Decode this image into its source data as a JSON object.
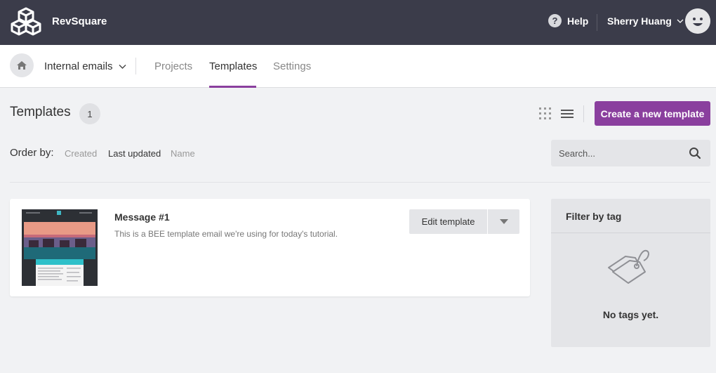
{
  "app": {
    "name": "RevSquare"
  },
  "topbar": {
    "help_label": "Help",
    "user_name": "Sherry Huang"
  },
  "subnav": {
    "project": "Internal emails",
    "tabs": [
      {
        "label": "Projects"
      },
      {
        "label": "Templates"
      },
      {
        "label": "Settings"
      }
    ]
  },
  "header": {
    "title": "Templates",
    "count": "1",
    "create_label": "Create a new template"
  },
  "order": {
    "label": "Order by:",
    "options": [
      {
        "label": "Created"
      },
      {
        "label": "Last updated"
      },
      {
        "label": "Name"
      }
    ]
  },
  "search": {
    "placeholder": "Search..."
  },
  "templates": [
    {
      "title": "Message #1",
      "description": "This is a BEE template email we're using for today's tutorial.",
      "edit_label": "Edit template"
    }
  ],
  "filter": {
    "title": "Filter by tag",
    "empty_text": "No tags yet."
  },
  "colors": {
    "topbar": "#3b3c4a",
    "accent": "#8a3f9e",
    "background": "#f1f2f4"
  }
}
